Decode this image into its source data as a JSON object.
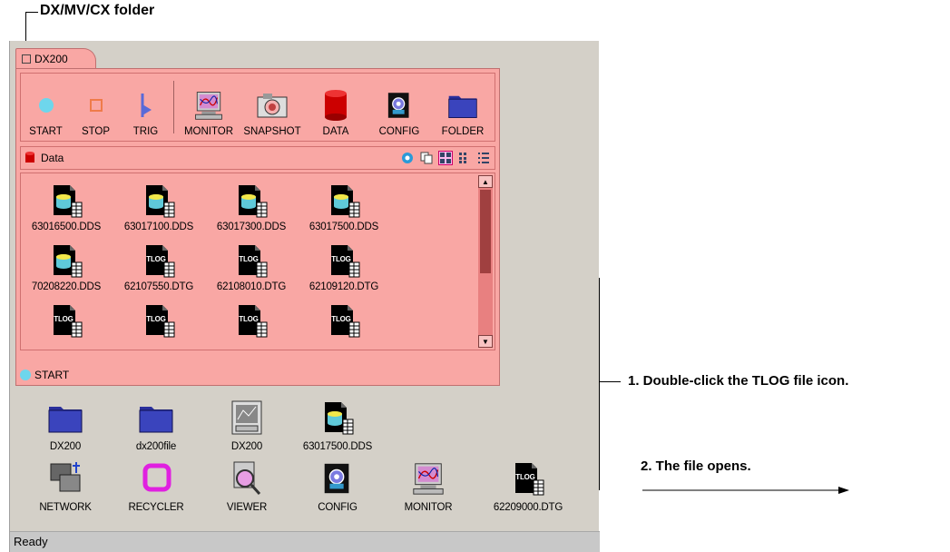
{
  "annotations": {
    "folder_label": "DX/MV/CX folder",
    "step1": "1. Double-click the TLOG file icon.",
    "step2": "2. The file opens."
  },
  "window": {
    "tab_label": "DX200",
    "toolbar": [
      {
        "label": "START",
        "icon": "start-icon"
      },
      {
        "label": "STOP",
        "icon": "stop-icon"
      },
      {
        "label": "TRIG",
        "icon": "trig-icon"
      },
      {
        "label": "MONITOR",
        "icon": "monitor-icon"
      },
      {
        "label": "SNAPSHOT",
        "icon": "camera-icon"
      },
      {
        "label": "DATA",
        "icon": "data-cylinder-icon"
      },
      {
        "label": "CONFIG",
        "icon": "config-icon"
      },
      {
        "label": "FOLDER",
        "icon": "folder-icon"
      }
    ],
    "data_header": {
      "label": "Data"
    },
    "files": [
      {
        "name": "63016500.DDS",
        "type": "dds"
      },
      {
        "name": "63017100.DDS",
        "type": "dds"
      },
      {
        "name": "63017300.DDS",
        "type": "dds"
      },
      {
        "name": "63017500.DDS",
        "type": "dds"
      },
      {
        "name": "70208220.DDS",
        "type": "dds"
      },
      {
        "name": "62107550.DTG",
        "type": "dtg"
      },
      {
        "name": "62108010.DTG",
        "type": "dtg"
      },
      {
        "name": "62109120.DTG",
        "type": "dtg"
      },
      {
        "name": "",
        "type": "dtg"
      },
      {
        "name": "",
        "type": "dtg"
      },
      {
        "name": "",
        "type": "dtg"
      },
      {
        "name": "",
        "type": "dtg"
      }
    ],
    "panel_status": "START"
  },
  "desktop": {
    "icons": [
      {
        "label": "DX200",
        "icon": "folder-icon"
      },
      {
        "label": "dx200file",
        "icon": "folder-icon"
      },
      {
        "label": "DX200",
        "icon": "monitor-screen-icon"
      },
      {
        "label": "63017500.DDS",
        "icon": "dds-file-icon"
      },
      {
        "label": "NETWORK",
        "icon": "network-icon"
      },
      {
        "label": "RECYCLER",
        "icon": "recycler-icon"
      },
      {
        "label": "VIEWER",
        "icon": "viewer-icon"
      },
      {
        "label": "CONFIG",
        "icon": "config-icon"
      },
      {
        "label": "MONITOR",
        "icon": "monitor-icon"
      },
      {
        "label": "62209000.DTG",
        "icon": "tlog-file-icon"
      }
    ]
  },
  "statusbar": {
    "text": "Ready"
  },
  "colors": {
    "folder_pink": "#f9a7a4",
    "desktop_bg": "#d4d0c8",
    "accent_blue": "#2c3aa8"
  }
}
